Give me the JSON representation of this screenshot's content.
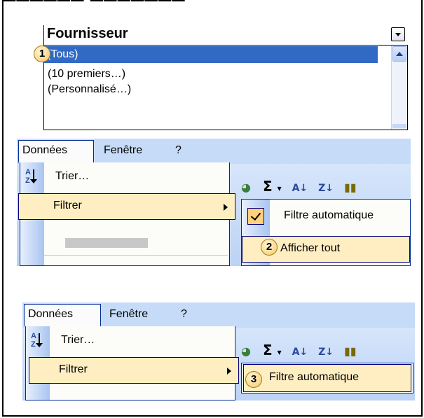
{
  "panel1": {
    "header_label": "Fournisseur",
    "badge": "1",
    "items": [
      "(Tous)",
      "(10 premiers…)",
      "(Personnalisé…)"
    ],
    "selected_index": 0
  },
  "panel2": {
    "menubar": [
      "Données",
      "Fenêtre",
      "?"
    ],
    "menu_items": [
      "Trier…",
      "Filtrer"
    ],
    "toolbar_glyphs": "Σ ▾",
    "submenu_items": [
      "Filtre automatique",
      "Afficher tout"
    ],
    "badge": "2"
  },
  "panel3": {
    "menubar": [
      "Données",
      "Fenêtre",
      "?"
    ],
    "menu_items": [
      "Trier…",
      "Filtrer"
    ],
    "toolbar_glyphs": "Σ ▾",
    "submenu_items": [
      "Filtre automatique"
    ],
    "badge": "3"
  },
  "colors": {
    "selection_blue": "#316ac5",
    "menubar_blue": "#c6dbf7",
    "highlight_yellow": "#ffeec2",
    "menu_border": "#002d96"
  },
  "icons": [
    "sort-ascending-icon",
    "sort-descending-icon",
    "sum-icon",
    "chart-icon",
    "chevron-down-icon",
    "scroll-up-icon",
    "checkmark-icon",
    "submenu-arrow-icon"
  ]
}
